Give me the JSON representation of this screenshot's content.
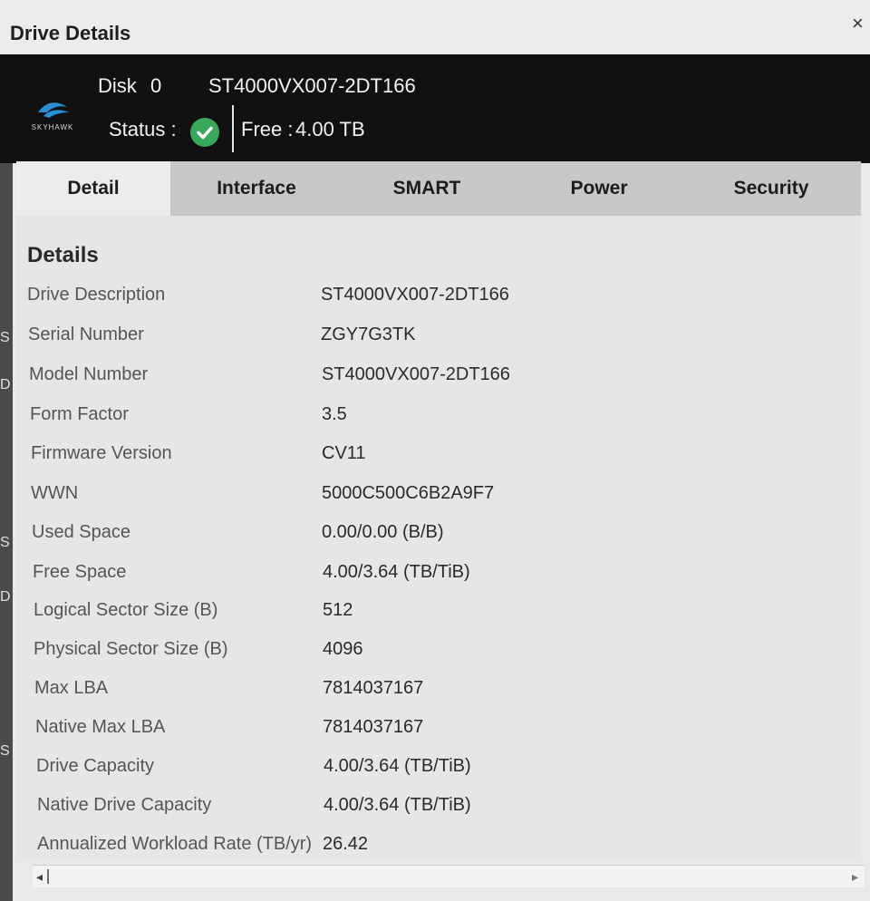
{
  "window": {
    "title": "Drive Details",
    "close_glyph": "×"
  },
  "header": {
    "logo_text": "SKYHAWK",
    "disk_label": "Disk",
    "disk_number": "0",
    "model": "ST4000VX007-2DT166",
    "status_label": "Status :",
    "free_label": "Free :",
    "free_value": "4.00 TB",
    "status_icon": "check-circle-icon",
    "status_color": "#3aa85a"
  },
  "tabs": [
    {
      "label": "Detail",
      "active": true
    },
    {
      "label": "Interface",
      "active": false
    },
    {
      "label": "SMART",
      "active": false
    },
    {
      "label": "Power",
      "active": false
    },
    {
      "label": "Security",
      "active": false
    }
  ],
  "details": {
    "section_title": "Details",
    "rows": [
      {
        "label": "Drive Description",
        "value": "ST4000VX007-2DT166"
      },
      {
        "label": "Serial Number",
        "value": "ZGY7G3TK"
      },
      {
        "label": "Model Number",
        "value": "ST4000VX007-2DT166"
      },
      {
        "label": "Form Factor",
        "value": "3.5"
      },
      {
        "label": "Firmware Version",
        "value": "CV11"
      },
      {
        "label": "WWN",
        "value": "5000C500C6B2A9F7"
      },
      {
        "label": "Used Space",
        "value": "0.00/0.00 (B/B)"
      },
      {
        "label": "Free Space",
        "value": "4.00/3.64 (TB/TiB)"
      },
      {
        "label": "Logical Sector Size (B)",
        "value": "512"
      },
      {
        "label": "Physical Sector Size (B)",
        "value": "4096"
      },
      {
        "label": "Max LBA",
        "value": "7814037167"
      },
      {
        "label": "Native Max LBA",
        "value": "7814037167"
      },
      {
        "label": "Drive Capacity",
        "value": "4.00/3.64 (TB/TiB)"
      },
      {
        "label": "Native Drive Capacity",
        "value": "4.00/3.64 (TB/TiB)"
      },
      {
        "label": "Annualized Workload Rate (TB/yr)",
        "value": "26.42"
      }
    ]
  },
  "scrollbar": {
    "left_glyph": "◂",
    "right_glyph": "▸"
  },
  "background_edge": {
    "items": [
      "S",
      "D",
      "S",
      "D",
      "S"
    ]
  }
}
